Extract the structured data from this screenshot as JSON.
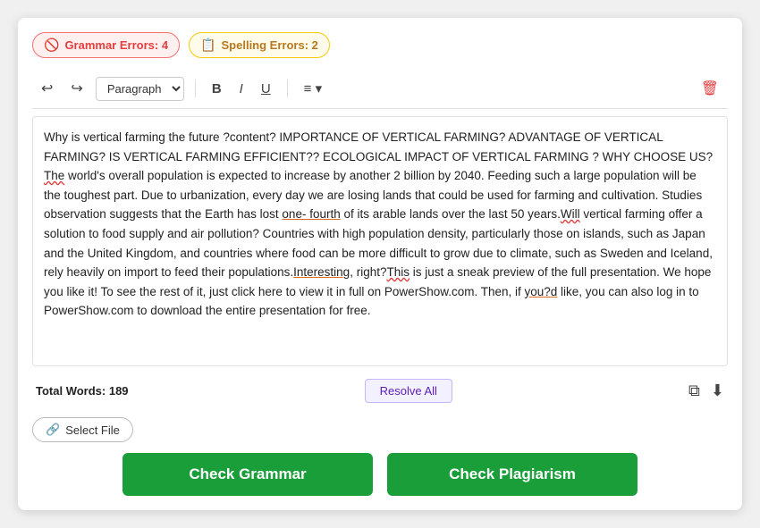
{
  "badges": {
    "grammar": {
      "icon": "🚫",
      "label": "Grammar Errors: 4"
    },
    "spelling": {
      "icon": "📋",
      "label": "Spelling Errors: 2"
    }
  },
  "toolbar": {
    "undo_label": "↩",
    "redo_label": "↪",
    "paragraph_label": "Paragraph",
    "bold_label": "B",
    "italic_label": "I",
    "underline_label": "U",
    "align_label": "≡ ▾",
    "trash_label": "🗑"
  },
  "editor": {
    "content": "Why is vertical farming the future ?content? IMPORTANCE OF VERTICAL FARMING? ADVANTAGE OF VERTICAL FARMING? IS VERTICAL FARMING EFFICIENT?? ECOLOGICAL IMPACT OF VERTICAL FARMING ? WHY CHOOSE US?"
  },
  "bottom": {
    "word_count": "Total Words: 189",
    "resolve_all": "Resolve All"
  },
  "select_file": {
    "icon": "🔗",
    "label": "Select File"
  },
  "actions": {
    "check_grammar": "Check Grammar",
    "check_plagiarism": "Check Plagiarism"
  }
}
